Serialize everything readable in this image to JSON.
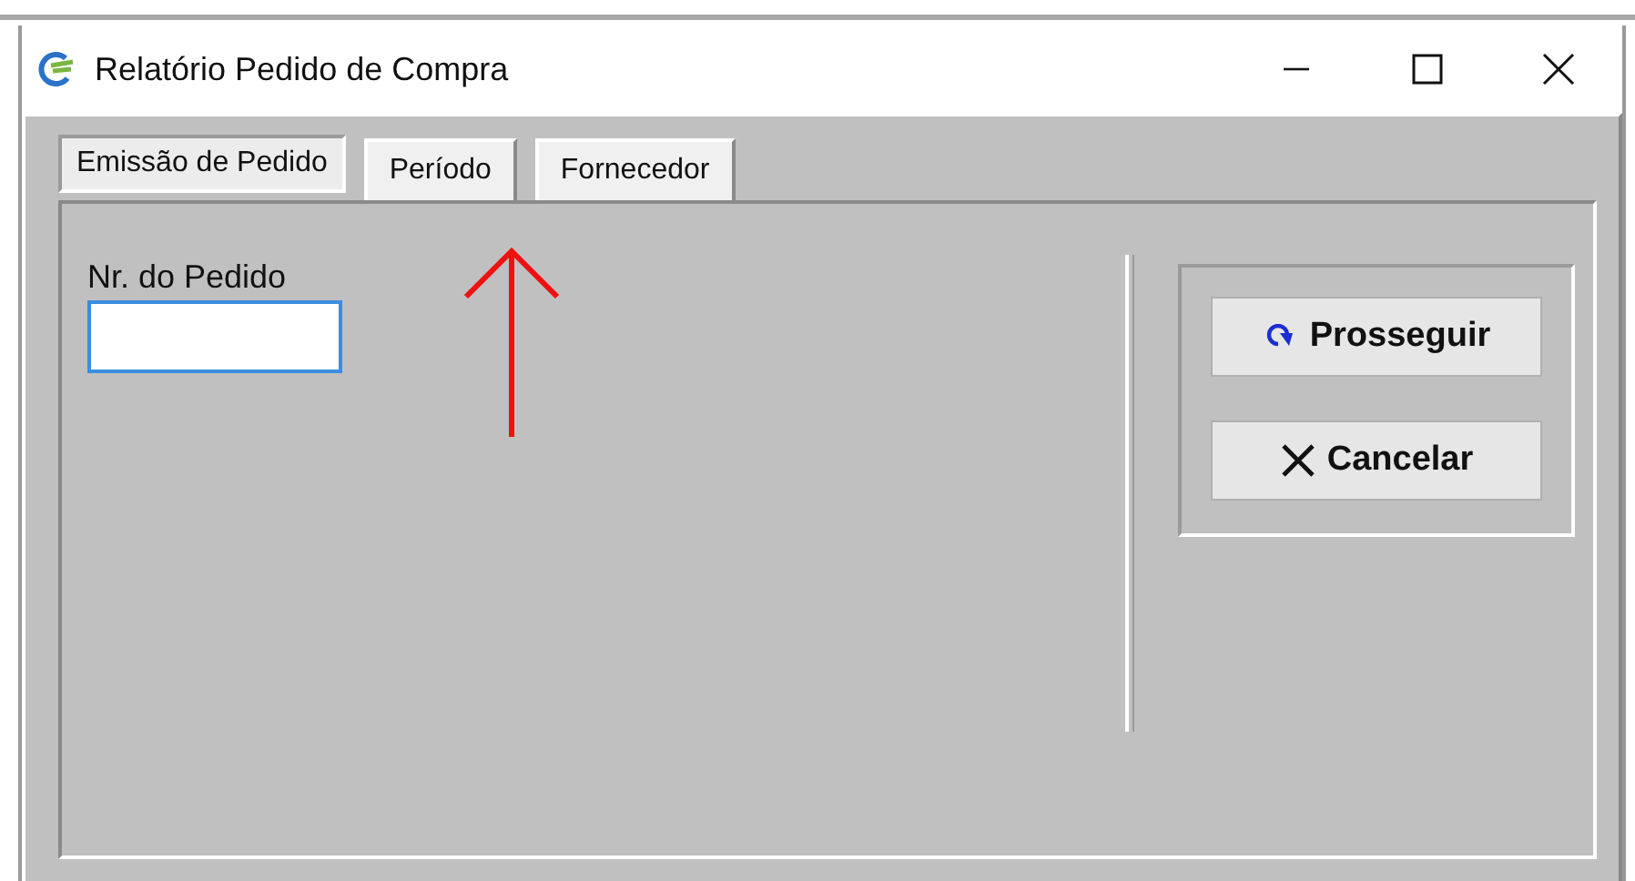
{
  "window": {
    "title": "Relatório Pedido de Compra"
  },
  "tabs": [
    {
      "label": "Emissão de Pedido",
      "selected": true
    },
    {
      "label": "Período",
      "selected": false
    },
    {
      "label": "Fornecedor",
      "selected": false
    }
  ],
  "order_number": {
    "label": "Nr. do Pedido",
    "focused": true
  },
  "buttons": [
    {
      "label": "Prosseguir",
      "kind": "proceed"
    },
    {
      "label": "Cancelar",
      "kind": "cancel"
    }
  ]
}
